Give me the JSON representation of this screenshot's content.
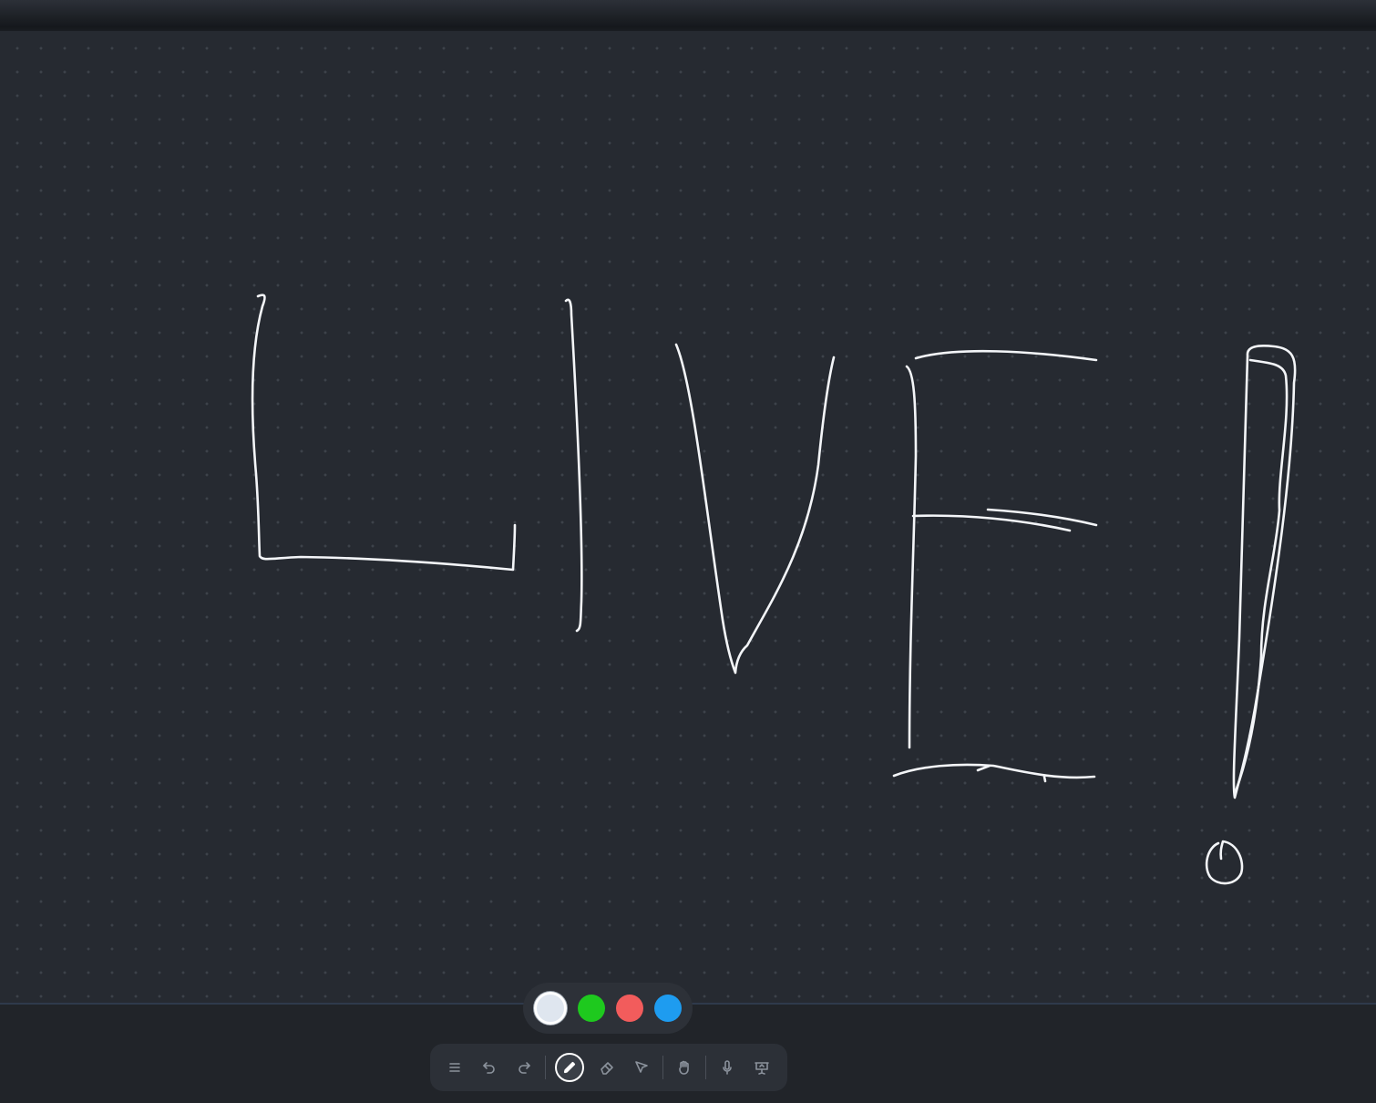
{
  "whiteboard": {
    "handwritten_text": "LIVE!",
    "background_color": "#262a31",
    "grid": "dotted",
    "stroke_color": "#f3f5f8"
  },
  "palette": {
    "colors": [
      {
        "name": "white",
        "hex": "#dfe6ef",
        "selected": true
      },
      {
        "name": "green",
        "hex": "#1ec91e",
        "selected": false
      },
      {
        "name": "red",
        "hex": "#f25c5c",
        "selected": false
      },
      {
        "name": "blue",
        "hex": "#1e9cf0",
        "selected": false
      }
    ]
  },
  "toolbar": {
    "tools": [
      "menu-icon",
      "undo-icon",
      "redo-icon",
      "pen-icon",
      "eraser-icon",
      "pointer-icon",
      "hand-icon",
      "microphone-icon",
      "presentation-icon"
    ],
    "active_tool": "pen-icon"
  }
}
